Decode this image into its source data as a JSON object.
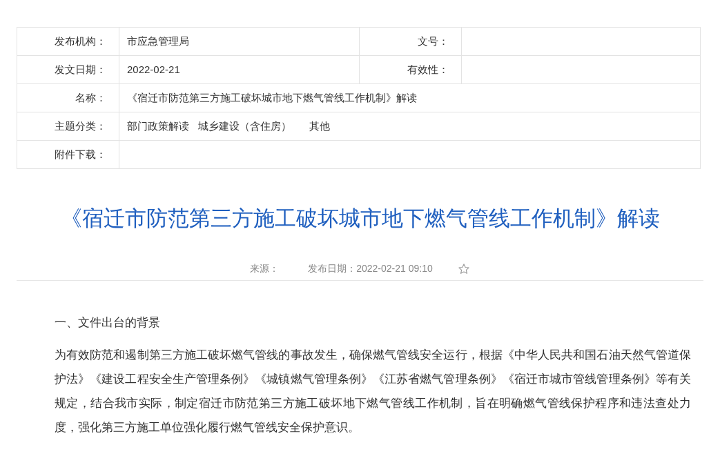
{
  "info_table": {
    "rows": [
      {
        "label": "发布机构：",
        "value": "市应急管理局",
        "label_2": "文号：",
        "value_2": ""
      },
      {
        "label": "发文日期：",
        "value": "2022-02-21",
        "label_2": "有效性：",
        "value_2": ""
      },
      {
        "label": "名称：",
        "value": "《宿迁市防范第三方施工破坏城市地下燃气管线工作机制》解读"
      },
      {
        "label": "主题分类：",
        "values": [
          "部门政策解读",
          "城乡建设（含住房）",
          "其他"
        ]
      },
      {
        "label": "附件下载：",
        "value": ""
      }
    ]
  },
  "article": {
    "title": "《宿迁市防范第三方施工破坏城市地下燃气管线工作机制》解读",
    "source_label": "来源：",
    "date": "发布日期：2022-02-21 09:10",
    "heading": "一、文件出台的背景",
    "paragraphs": [
      "为有效防范和遏制第三方施工破坏燃气管线的事故发生，确保燃气管线安全运行，根据《中华人民共和国石油天然气管道保护法》《建设工程安全生产管理条例》《城镇燃气管理条例》《江苏省燃气管理条例》《宿迁市城市管线管理条例》等有关规定，结合我市实际，制定宿迁市防范第三方施工破坏地下燃气管线工作机制，旨在明确燃气管线保护程序和违法查处力度，强化第三方施工单位强化履行燃气管线安全保护意识。"
    ]
  }
}
